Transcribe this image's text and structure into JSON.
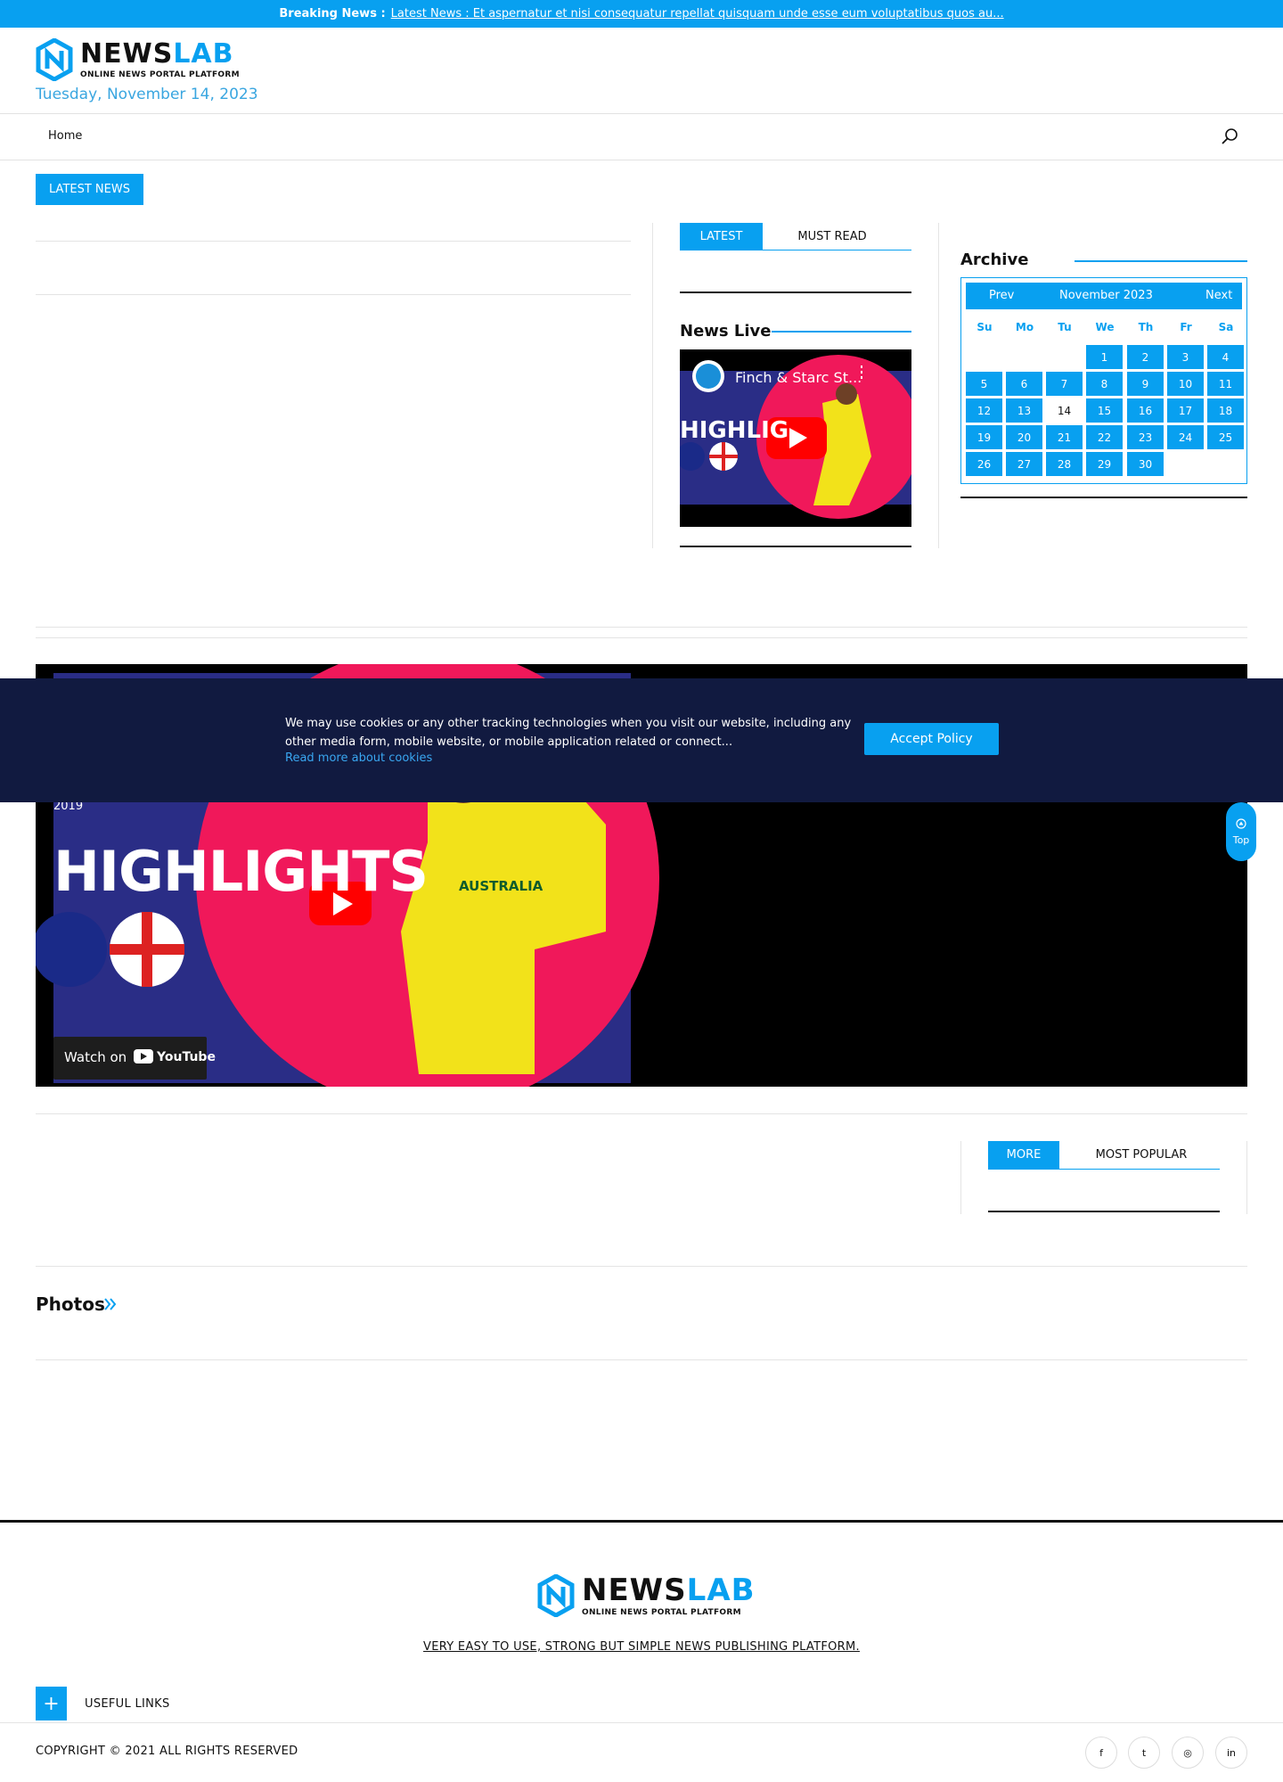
{
  "breaking": {
    "label": "Breaking News :",
    "text": "Latest News : Et aspernatur et nisi consequatur repellat quisquam unde esse eum voluptatibus quos au..."
  },
  "brand": {
    "name_part1": "NEWS",
    "name_part2": "LAB",
    "tagline": "ONLINE NEWS PORTAL PLATFORM",
    "accent": "#08a0f0"
  },
  "header": {
    "date": "Tuesday, November 14, 2023"
  },
  "nav": {
    "home": "Home",
    "search_icon": "search-icon"
  },
  "latest_news_button": "LATEST NEWS",
  "tabs_top": {
    "latest": "LATEST",
    "must_read": "MUST READ"
  },
  "news_live": {
    "title": "News Live",
    "video_title": "Finch & Starc St...",
    "overlay_text": "HIGHLIG"
  },
  "archive": {
    "title": "Archive",
    "prev": "Prev",
    "month": "November 2023",
    "next": "Next",
    "day_names": [
      "Su",
      "Mo",
      "Tu",
      "We",
      "Th",
      "Fr",
      "Sa"
    ],
    "first_weekday": 3,
    "days_in_month": 30,
    "today": 14
  },
  "big_video": {
    "overlay_text": "HIGHLIGHTS",
    "year_badge": "2019",
    "shirt_text": "AUSTRALIA",
    "watch_on": "Watch on",
    "youtube": "YouTube"
  },
  "cookie": {
    "text": "We may use cookies or any other tracking technologies when you visit our website, including any other media form, mobile website, or mobile application related or connect...",
    "link": "Read more about cookies",
    "accept": "Accept Policy"
  },
  "top_button": "Top",
  "tabs_bottom": {
    "more": "MORE",
    "most_popular": "MOST POPULAR"
  },
  "photos": {
    "title": "Photos"
  },
  "footer": {
    "tagline": "VERY EASY TO USE, STRONG BUT SIMPLE NEWS PUBLISHING PLATFORM.",
    "useful_links": "USEFUL LINKS",
    "plus": "+",
    "copyright": "COPYRIGHT © 2021 ALL RIGHTS RESERVED",
    "social": [
      {
        "icon": "facebook-icon",
        "glyph": "f"
      },
      {
        "icon": "twitter-icon",
        "glyph": "t"
      },
      {
        "icon": "instagram-icon",
        "glyph": "◎"
      },
      {
        "icon": "linkedin-icon",
        "glyph": "in"
      }
    ]
  }
}
